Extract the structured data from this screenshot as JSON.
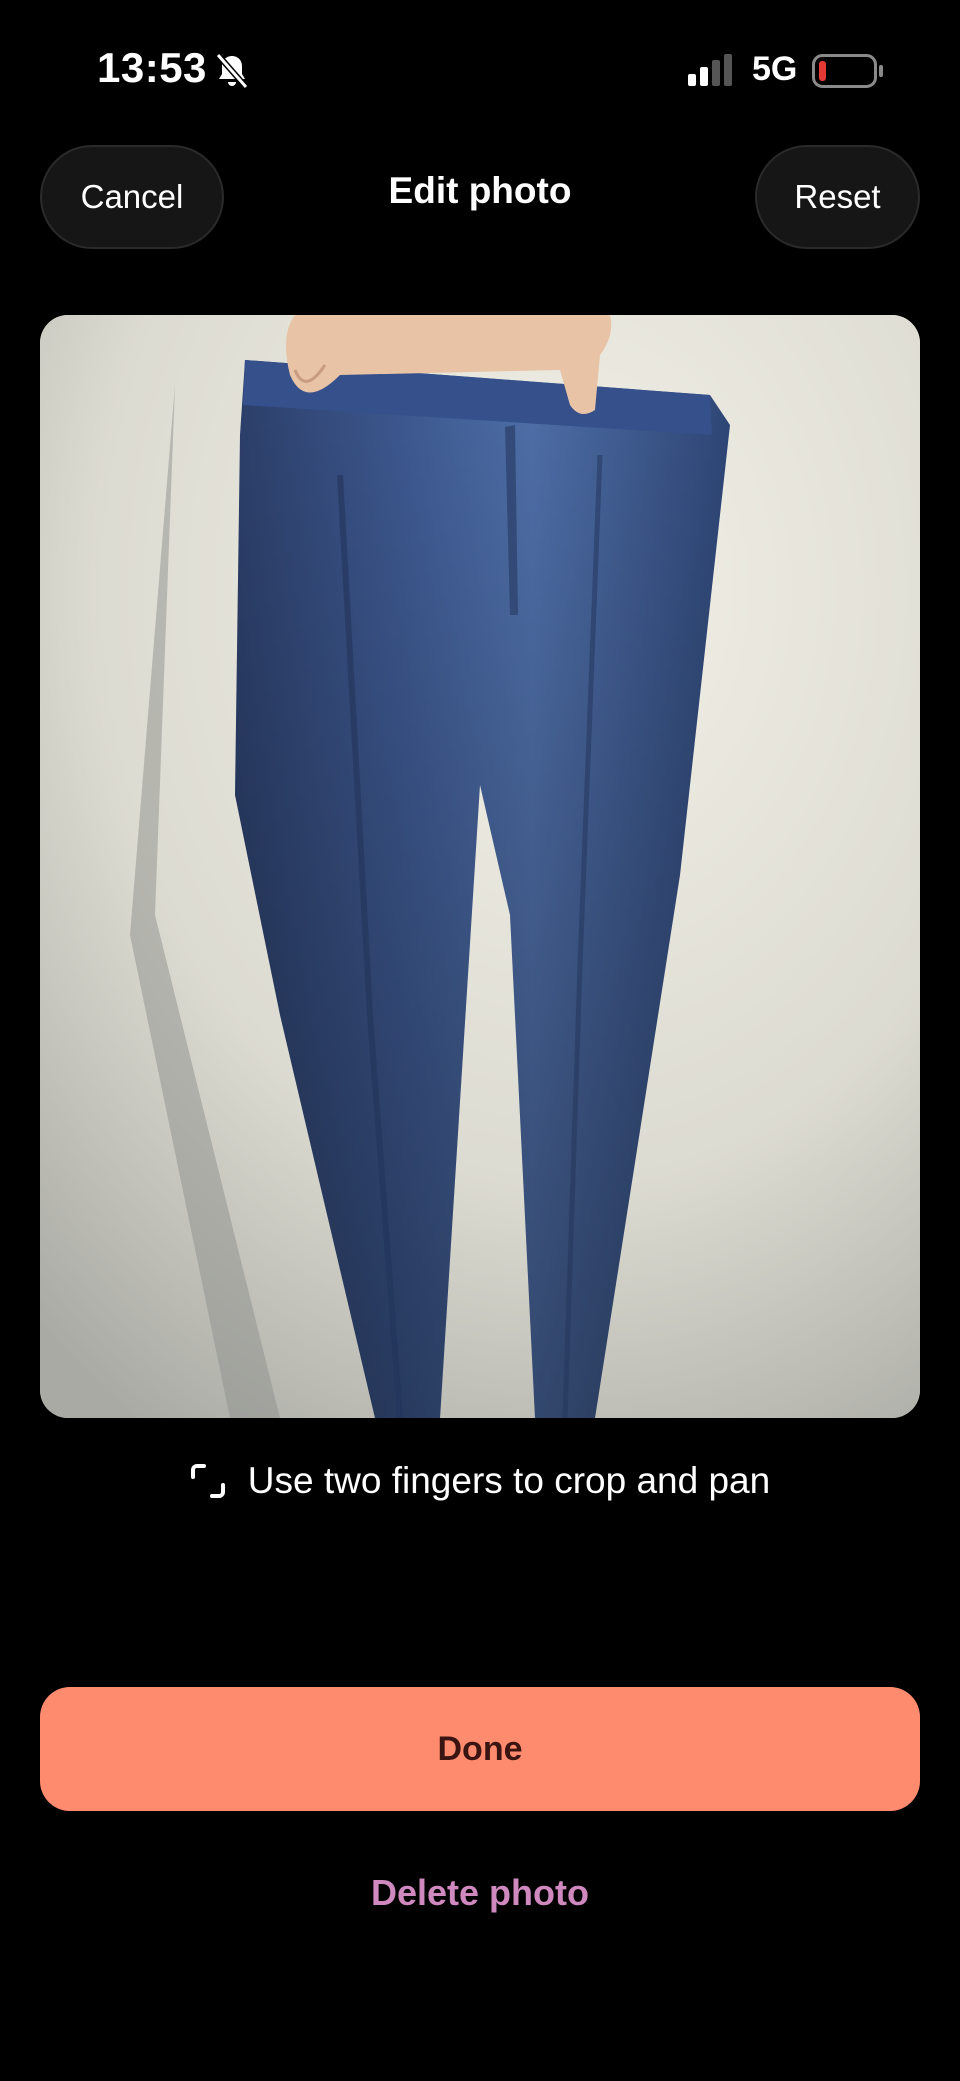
{
  "status_bar": {
    "time": "13:53",
    "network": "5G",
    "icons": [
      "bell-off-icon",
      "signal-icon",
      "battery-icon"
    ]
  },
  "header": {
    "cancel_label": "Cancel",
    "title": "Edit photo",
    "reset_label": "Reset"
  },
  "photo": {
    "description_icon": "photo",
    "subject": "blue trousers"
  },
  "hint": {
    "icon": "crop-icon",
    "text": "Use two fingers to crop and pan"
  },
  "actions": {
    "done_label": "Done",
    "delete_label": "Delete photo"
  },
  "colors": {
    "background": "#000000",
    "button_surface": "#161616",
    "done_button": "#ff8b6f",
    "done_text": "#3a1410",
    "delete_text": "#d089bf",
    "battery_low": "#e53935"
  }
}
